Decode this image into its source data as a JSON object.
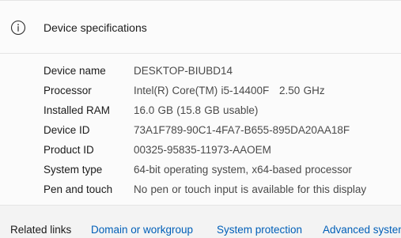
{
  "header": {
    "title": "Device specifications",
    "icon": "info-icon"
  },
  "specs": [
    {
      "label": "Device name",
      "value": "DESKTOP-BIUBD14"
    },
    {
      "label": "Processor",
      "value": "Intel(R) Core(TM) i5-14400F   2.50 GHz"
    },
    {
      "label": "Installed RAM",
      "value": "16.0 GB (15.8 GB usable)"
    },
    {
      "label": "Device ID",
      "value": "73A1F789-90C1-4FA7-B655-895DA20AA18F"
    },
    {
      "label": "Product ID",
      "value": "00325-95835-11973-AAOEM"
    },
    {
      "label": "System type",
      "value": "64-bit operating system, x64-based processor"
    },
    {
      "label": "Pen and touch",
      "value": "No pen or touch input is available for this display"
    }
  ],
  "related": {
    "title": "Related links",
    "links": [
      "Domain or workgroup",
      "System protection",
      "Advanced system settings"
    ]
  },
  "colors": {
    "link": "#005fb8",
    "card_bg": "#fbfbfb",
    "page_bg": "#f3f3f3"
  }
}
